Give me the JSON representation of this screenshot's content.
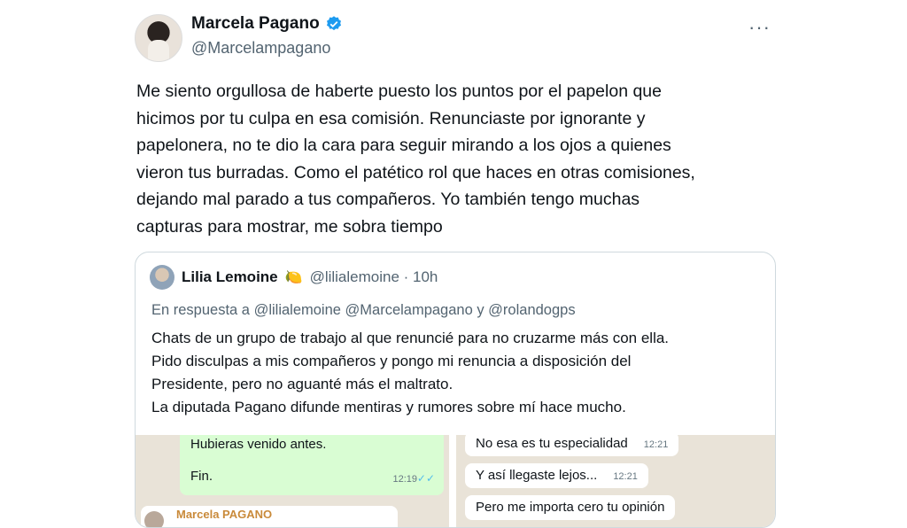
{
  "tweet": {
    "author_name": "Marcela Pagano",
    "author_handle": "@Marcelampagano",
    "more_label": "···",
    "text": "Me siento orgullosa de haberte puesto los puntos por el papelon que\nhicimos por tu culpa en esa comisión. Renunciaste por ignorante y\npapelonera, no te dio la cara para seguir mirando a los ojos a quienes\nvieron tus burradas. Como el patético rol que haces en otras comisiones,\ndejando mal parado a tus compañeros. Yo también tengo muchas\ncapturas para mostrar, me sobra tiempo"
  },
  "quote": {
    "author_name": "Lilia Lemoine",
    "emoji": "🍋",
    "meta": "@lilialemoine · 10h",
    "reply_to": "En respuesta a @lilialemoine @Marcelampagano y @rolandogps",
    "text": "Chats de un grupo de trabajo al que renuncié para no cruzarme más con ella.\nPido disculpas a mis compañeros y pongo mi renuncia a disposición del\nPresidente, pero no aguanté más el maltrato.\nLa diputada Pagano difunde mentiras y rumores sobre mí hace mucho."
  },
  "chat_left": {
    "line1": "Hubieras venido antes.",
    "line2": "Fin.",
    "time": "12:19",
    "ticks": "✓✓",
    "sender": "Marcela PAGANO"
  },
  "chat_right": {
    "messages": [
      {
        "text": "No esa es tu especialidad",
        "time": "12:21"
      },
      {
        "text": "Y así llegaste lejos...",
        "time": "12:21"
      },
      {
        "text": "Pero me importa cero tu opinión",
        "time": ""
      }
    ]
  },
  "colors": {
    "verified": "#1d9bf0",
    "chat_bg": "#e9e3d8",
    "outgoing_bubble": "#d9fdd3"
  }
}
